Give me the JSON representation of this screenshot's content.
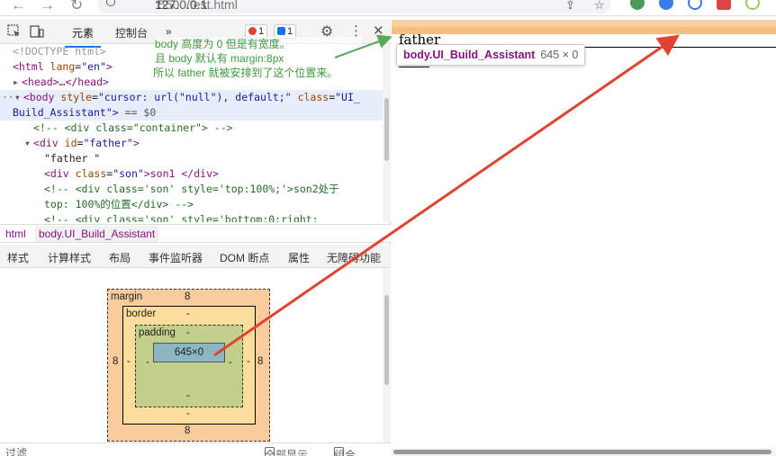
{
  "browser": {
    "url_host": "127.0.0.1",
    "url_rest": ":5500/test.html"
  },
  "devtools": {
    "tabs": {
      "elements": "元素",
      "console": "控制台",
      "more": "»"
    },
    "errors_count": "1",
    "messages_count": "1",
    "tree": {
      "l1": "<!DOCTYPE html>",
      "l2_tag_open": "<html",
      "l2_attr": "lang",
      "l2_val": "\"en\"",
      "l2_tag_close": ">",
      "l3": "<head>…</head>",
      "l4_a": "<body",
      "l4_attr1": "style",
      "l4_val1": "\"cursor: url(\"null\"), default;\"",
      "l4_attr2": "class",
      "l4_val2": "\"UI_",
      "l5": "Build_Assistant\">",
      "l5_eq": "== $0",
      "l6": "<!-- <div class=\"container\"> -->",
      "l7_tag": "<div",
      "l7_attr": "id",
      "l7_val": "\"father\"",
      "l7_close": ">",
      "l8": "\"father \"",
      "l9_tag": "<div",
      "l9_attr": "class",
      "l9_val": "\"son\"",
      "l9_text": ">son1 </div>",
      "l10": "<!-- <div class='son' style='top:100%;'>son2处于",
      "l11": "top: 100%的位置</div> -->",
      "l12": "<!-- <div class='son' style='bottom:0;right:"
    },
    "breadcrumb": {
      "html": "html",
      "body": "body.UI_Build_Assistant"
    },
    "subtabs": {
      "styles": "样式",
      "computed": "计算样式",
      "layout": "布局",
      "listeners": "事件监听器",
      "dom_breakpoints": "DOM 断点",
      "properties": "属性",
      "accessibility": "无障碍功能"
    },
    "boxmodel": {
      "margin_label": "margin",
      "margin_top": "8",
      "margin_bottom": "8",
      "margin_left": "8",
      "margin_right": "8",
      "border_label": "border",
      "border_top": "-",
      "border_bottom": "-",
      "border_left": "-",
      "border_right": "-",
      "padding_label": "padding",
      "padding_top": "-",
      "padding_bottom": "-",
      "padding_left": "-",
      "padding_right": "-",
      "content": "645×0"
    },
    "filter": {
      "label": "过滤",
      "show_all": "全部显示",
      "group": "组合"
    }
  },
  "note": {
    "line1": "body 高度为 0 但是有宽度。",
    "line2": "且 body 默认有 margin:8px",
    "line3": "所以 father 就被安排到了这个位置来。"
  },
  "viewport": {
    "father_text": "father",
    "tooltip_name": "body.UI_Build_Assistant",
    "tooltip_dims": "645 × 0"
  },
  "colors": {
    "arrow_red": "#e0432f",
    "arrow_green": "#5aa65a",
    "margin_highlight": "#f6b26b"
  }
}
